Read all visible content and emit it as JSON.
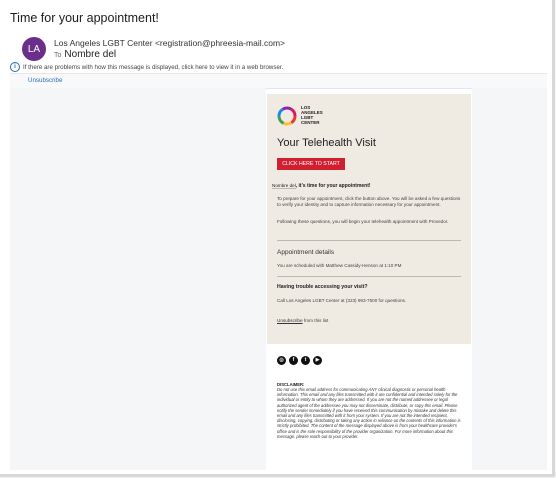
{
  "email": {
    "subject": "Time for your appointment!",
    "avatar_initials": "LA",
    "from": "Los Angeles LGBT Center <registration@phreesia-mail.com>",
    "to_label": "To",
    "to_name": "Nombre del",
    "info_bar": "If there are problems with how this message is displayed, click here to view it in a web browser.",
    "unsubscribe_link": "Unsubscribe"
  },
  "body": {
    "logo_text": [
      "LOS",
      "ANGELES",
      "LGBT",
      "CENTER"
    ],
    "title": "Your Telehealth Visit",
    "cta_label": "CLICK HERE TO START",
    "greeting_name": "Nombre del",
    "greeting_text": ", it's time for your appointment!",
    "para1": "To prepare for your appointment, click the button above. You will be asked a few questions to verify your identity and to capture information necessary for your appointment.",
    "para2": "Following these questions, you will begin your telehealth appointment with Provedor.",
    "details_title": "Appointment details",
    "details_text": "You are scheduled with Matthew Cassidy-Henson at 1:10 PM",
    "trouble_title": "Having trouble accessing your visit?",
    "trouble_text": "Call Los Angeles LGBT Center at (323) 993-7500 for questions.",
    "unsub_link": "Unsubscribe",
    "unsub_rest": " from this list"
  },
  "footer": {
    "social_icons": [
      "instagram-icon",
      "facebook-icon",
      "twitter-icon",
      "youtube-icon"
    ],
    "disclaimer_title": "DISCLAIMER:",
    "disclaimer_text": "Do not use this email address for communicating ANY clinical diagnostic or personal health information. This email and any files transmitted with it are confidential and intended solely for the individual or entity to whom they are addressed. If you are not the named addressee or legal authorized agent of the addressee you may not disseminate, distribute, or copy this email. Please notify the sender immediately if you have received this communication by mistake and delete this email and any files transmitted with it from your system. If you are not the intended recipient, disclosing, copying, distributing or taking any action in reliance on the contents of this information is strictly prohibited. The content of the message displayed above is from your healthcare provider's office and is the sole responsibility of the provider organization. For more information about this message, please reach out to your provider."
  },
  "colors": {
    "accent_red": "#d0202f",
    "avatar_purple": "#6b2e8a",
    "card_bg": "#efeae2",
    "link_blue": "#2b6cb0"
  }
}
